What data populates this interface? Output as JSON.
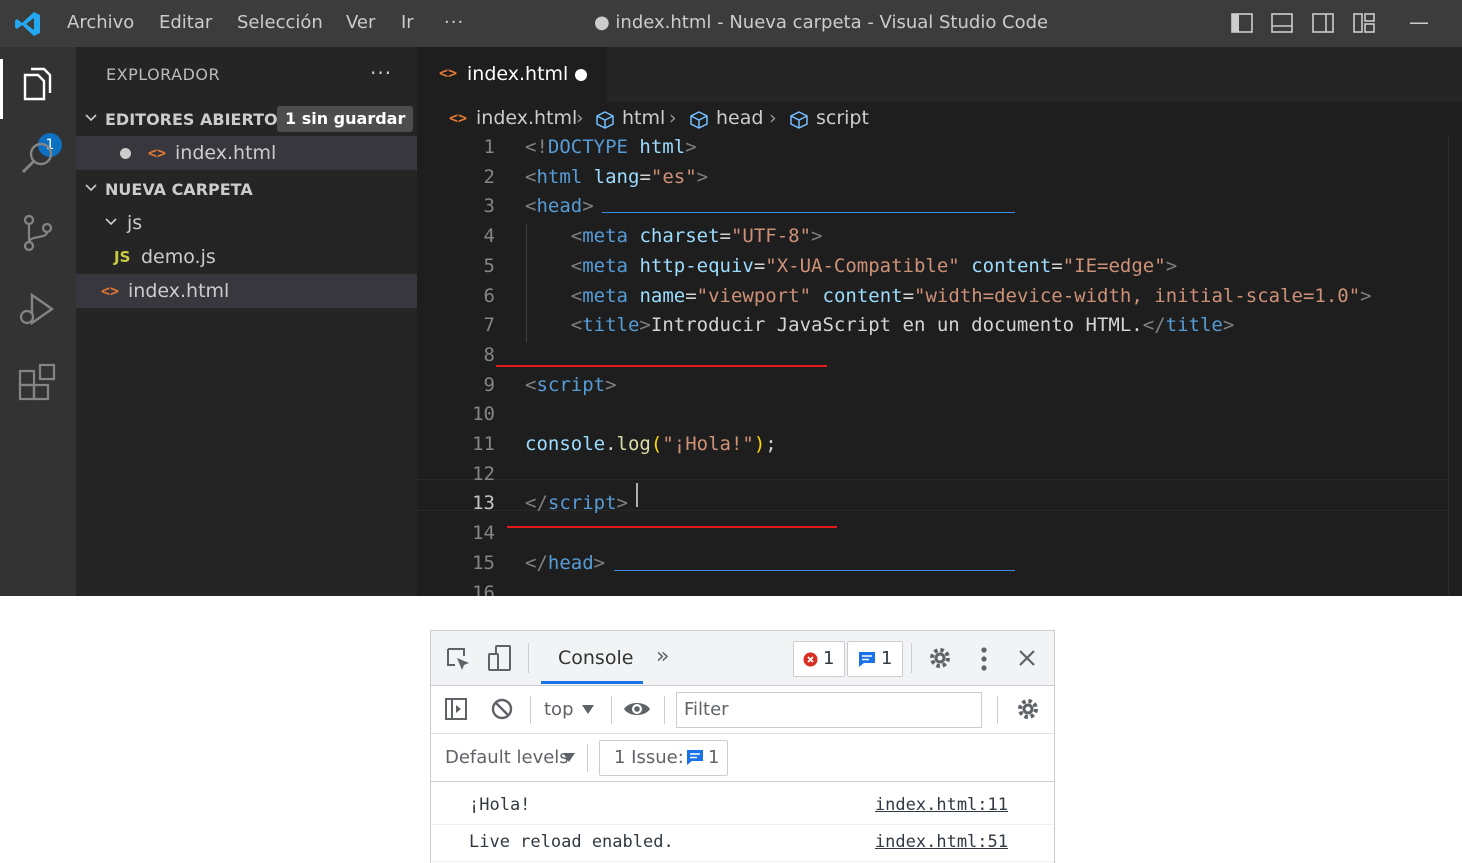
{
  "titlebar": {
    "menu": [
      "Archivo",
      "Editar",
      "Selección",
      "Ver",
      "Ir",
      "···"
    ],
    "title": "● index.html - Nueva carpeta - Visual Studio Code",
    "minimize": "—"
  },
  "activitybar": {
    "badge": "1"
  },
  "sidebar": {
    "header": "EXPLORADOR",
    "dots": "···",
    "open_editors": {
      "label": "EDITORES ABIERTOS",
      "badge": "1 sin guardar",
      "items": [
        "index.html"
      ]
    },
    "folder": {
      "label": "NUEVA CARPETA",
      "subfolder": "js",
      "subfiles": [
        "demo.js"
      ],
      "files": [
        "index.html"
      ]
    },
    "js_icon": "JS",
    "html_icon": "<>"
  },
  "tab": {
    "label": "index.html"
  },
  "breadcrumb": [
    "index.html",
    "html",
    "head",
    "script"
  ],
  "code": {
    "line_numbers": [
      "1",
      "2",
      "3",
      "4",
      "5",
      "6",
      "7",
      "8",
      "9",
      "10",
      "11",
      "12",
      "13",
      "14",
      "15",
      "16"
    ],
    "lines": [
      [
        [
          "p",
          "<!"
        ],
        [
          "t",
          "DOCTYPE"
        ],
        [
          "x",
          " "
        ],
        [
          "a",
          "html"
        ],
        [
          "p",
          ">"
        ]
      ],
      [
        [
          "p",
          "<"
        ],
        [
          "t",
          "html"
        ],
        [
          "x",
          " "
        ],
        [
          "a",
          "lang"
        ],
        [
          "x",
          "="
        ],
        [
          "s",
          "\"es\""
        ],
        [
          "p",
          ">"
        ]
      ],
      [
        [
          "p",
          "<"
        ],
        [
          "t",
          "head"
        ],
        [
          "p",
          ">"
        ]
      ],
      [
        [
          "x",
          "    "
        ],
        [
          "p",
          "<"
        ],
        [
          "t",
          "meta"
        ],
        [
          "x",
          " "
        ],
        [
          "a",
          "charset"
        ],
        [
          "x",
          "="
        ],
        [
          "s",
          "\"UTF-8\""
        ],
        [
          "p",
          ">"
        ]
      ],
      [
        [
          "x",
          "    "
        ],
        [
          "p",
          "<"
        ],
        [
          "t",
          "meta"
        ],
        [
          "x",
          " "
        ],
        [
          "a",
          "http-equiv"
        ],
        [
          "x",
          "="
        ],
        [
          "s",
          "\"X-UA-Compatible\""
        ],
        [
          "x",
          " "
        ],
        [
          "a",
          "content"
        ],
        [
          "x",
          "="
        ],
        [
          "s",
          "\"IE=edge\""
        ],
        [
          "p",
          ">"
        ]
      ],
      [
        [
          "x",
          "    "
        ],
        [
          "p",
          "<"
        ],
        [
          "t",
          "meta"
        ],
        [
          "x",
          " "
        ],
        [
          "a",
          "name"
        ],
        [
          "x",
          "="
        ],
        [
          "s",
          "\"viewport\""
        ],
        [
          "x",
          " "
        ],
        [
          "a",
          "content"
        ],
        [
          "x",
          "="
        ],
        [
          "s",
          "\"width=device-width, initial-scale=1.0\""
        ],
        [
          "p",
          ">"
        ]
      ],
      [
        [
          "x",
          "    "
        ],
        [
          "p",
          "<"
        ],
        [
          "t",
          "title"
        ],
        [
          "p",
          ">"
        ],
        [
          "x",
          "Introducir JavaScript en un documento HTML."
        ],
        [
          "p",
          "</"
        ],
        [
          "t",
          "title"
        ],
        [
          "p",
          ">"
        ]
      ],
      [],
      [
        [
          "p",
          "<"
        ],
        [
          "t",
          "script"
        ],
        [
          "p",
          ">"
        ]
      ],
      [],
      [
        [
          "o",
          "console"
        ],
        [
          "x",
          "."
        ],
        [
          "f",
          "log"
        ],
        [
          "b",
          "("
        ],
        [
          "s",
          "\"¡Hola!\""
        ],
        [
          "b",
          ")"
        ],
        [
          "x",
          ";"
        ]
      ],
      [],
      [
        [
          "p",
          "</"
        ],
        [
          "t",
          "script"
        ],
        [
          "p",
          ">"
        ]
      ],
      [],
      [
        [
          "p",
          "</"
        ],
        [
          "t",
          "head"
        ],
        [
          "p",
          ">"
        ]
      ],
      []
    ]
  },
  "devtools": {
    "tab_label": "Console",
    "more": "»",
    "error_count": "1",
    "info_count": "1",
    "context": "top",
    "filter_placeholder": "Filter",
    "levels": "Default levels",
    "issues_label": "1 Issue:",
    "issues_count": "1",
    "messages": [
      {
        "text": "¡Hola!",
        "source": "index.html:11"
      },
      {
        "text": "Live reload enabled.",
        "source": "index.html:51"
      }
    ]
  },
  "colors": {
    "accent": "#007acc",
    "annotation_red": "#e51a1a",
    "annotation_blue": "#3e8de0",
    "devtools_blue": "#1a73e8",
    "error_red": "#d93025"
  }
}
